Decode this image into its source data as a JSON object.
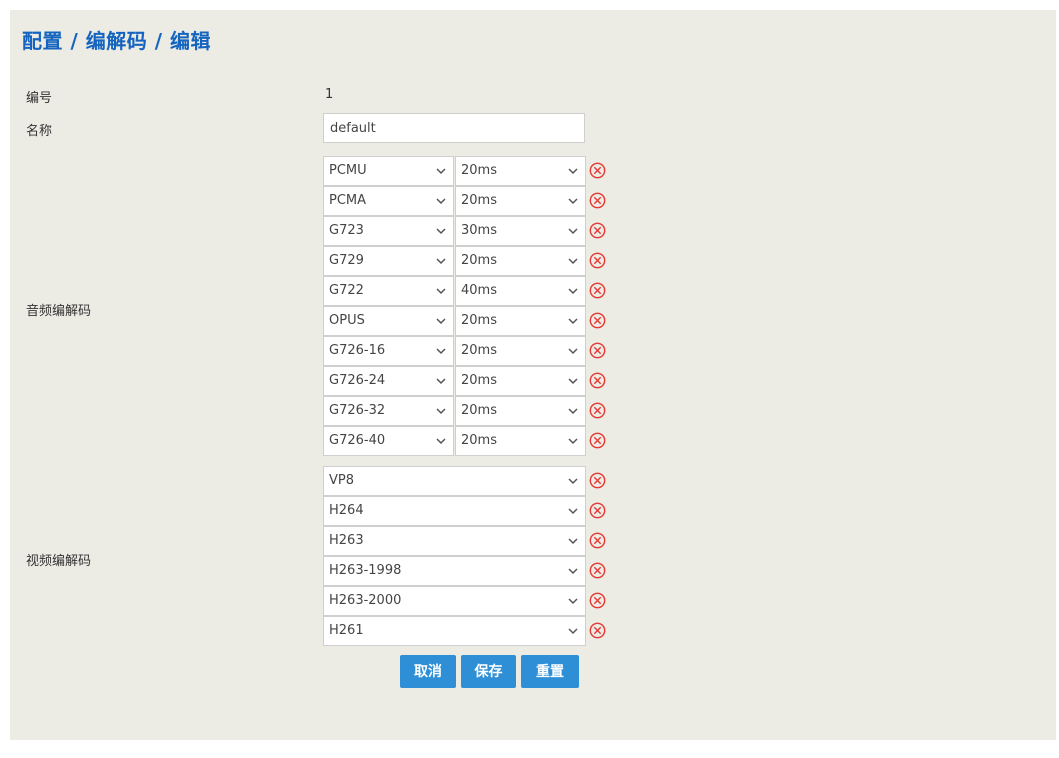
{
  "header": {
    "title": "配置 / 编解码 / 编辑"
  },
  "form": {
    "id_label": "编号",
    "id_value": "1",
    "name_label": "名称",
    "name_value": "default",
    "audio_label": "音频编解码",
    "video_label": "视频编解码"
  },
  "audio_codecs": [
    {
      "codec": "PCMU",
      "ptime": "20ms"
    },
    {
      "codec": "PCMA",
      "ptime": "20ms"
    },
    {
      "codec": "G723",
      "ptime": "30ms"
    },
    {
      "codec": "G729",
      "ptime": "20ms"
    },
    {
      "codec": "G722",
      "ptime": "40ms"
    },
    {
      "codec": "OPUS",
      "ptime": "20ms"
    },
    {
      "codec": "G726-16",
      "ptime": "20ms"
    },
    {
      "codec": "G726-24",
      "ptime": "20ms"
    },
    {
      "codec": "G726-32",
      "ptime": "20ms"
    },
    {
      "codec": "G726-40",
      "ptime": "20ms"
    }
  ],
  "video_codecs": [
    "VP8",
    "H264",
    "H263",
    "H263-1998",
    "H263-2000",
    "H261"
  ],
  "buttons": {
    "cancel": "取消",
    "save": "保存",
    "reset": "重置"
  },
  "colors": {
    "title": "#1565c0",
    "button": "#2e8fd6",
    "delete": "#e53935",
    "panel": "#ecebe4"
  }
}
